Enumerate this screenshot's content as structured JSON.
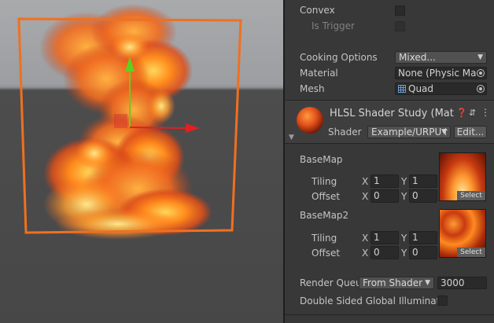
{
  "scene": {},
  "collider": {
    "convex_label": "Convex",
    "is_trigger_label": "Is Trigger",
    "cooking_options_label": "Cooking Options",
    "cooking_options_value": "Mixed...",
    "material_label": "Material",
    "material_value": "None (Physic Ma",
    "mesh_label": "Mesh",
    "mesh_value": "Quad"
  },
  "material_header": {
    "title": "HLSL Shader Study (Mat",
    "shader_label": "Shader",
    "shader_value": "Example/URPU↑",
    "edit_label": "Edit..."
  },
  "properties": {
    "basemap": {
      "label": "BaseMap",
      "tiling_label": "Tiling",
      "offset_label": "Offset",
      "tiling_x": "1",
      "tiling_y": "1",
      "offset_x": "0",
      "offset_y": "0",
      "select_label": "Select"
    },
    "basemap2": {
      "label": "BaseMap2",
      "tiling_label": "Tiling",
      "offset_label": "Offset",
      "tiling_x": "1",
      "tiling_y": "1",
      "offset_x": "0",
      "offset_y": "0",
      "select_label": "Select"
    },
    "axis_x": "X",
    "axis_y": "Y",
    "render_queue_label": "Render Queu",
    "render_queue_mode": "From Shader",
    "render_queue_value": "3000",
    "double_sided_label": "Double Sided Global Illuminatic"
  },
  "colors": {
    "selection_outline": "#f07020",
    "gizmo_x": "#e02020",
    "gizmo_y": "#60d020",
    "panel_bg": "#383838"
  }
}
